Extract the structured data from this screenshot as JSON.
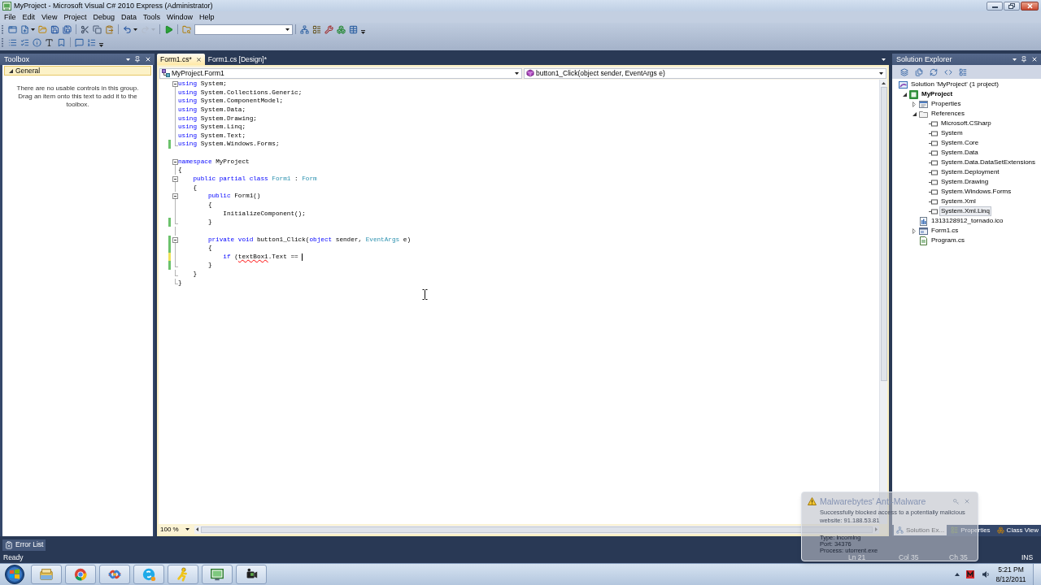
{
  "window": {
    "title": "MyProject - Microsoft Visual C# 2010 Express (Administrator)"
  },
  "menu": [
    "File",
    "Edit",
    "View",
    "Project",
    "Debug",
    "Data",
    "Tools",
    "Window",
    "Help"
  ],
  "toolbars": [
    [
      {
        "kind": "button",
        "disabled": false
      },
      {
        "kind": "split",
        "disabled": false
      },
      {
        "kind": "button",
        "disabled": false
      },
      {
        "kind": "button",
        "disabled": false
      },
      {
        "kind": "button",
        "disabled": false
      },
      {
        "kind": "separator"
      },
      {
        "kind": "button",
        "disabled": false
      },
      {
        "kind": "button",
        "disabled": false
      },
      {
        "kind": "button",
        "disabled": false
      },
      {
        "kind": "separator"
      },
      {
        "kind": "split",
        "disabled": false
      },
      {
        "kind": "split",
        "disabled": true
      },
      {
        "kind": "separator"
      },
      {
        "kind": "button",
        "disabled": false
      },
      {
        "kind": "separator"
      },
      {
        "kind": "button",
        "disabled": false
      },
      {
        "kind": "combo"
      },
      {
        "kind": "separator"
      },
      {
        "kind": "button",
        "disabled": false
      },
      {
        "kind": "button",
        "disabled": false
      },
      {
        "kind": "button",
        "disabled": false
      },
      {
        "kind": "button",
        "disabled": false
      },
      {
        "kind": "button",
        "disabled": false
      },
      {
        "kind": "overflow"
      }
    ],
    [
      {
        "kind": "button",
        "disabled": false
      },
      {
        "kind": "button",
        "disabled": false
      },
      {
        "kind": "button",
        "disabled": false
      },
      {
        "kind": "button",
        "disabled": false
      },
      {
        "kind": "button",
        "disabled": false
      },
      {
        "kind": "separator"
      },
      {
        "kind": "button",
        "disabled": false
      },
      {
        "kind": "button",
        "disabled": false
      },
      {
        "kind": "overflow"
      }
    ]
  ],
  "toolbox": {
    "title": "Toolbox",
    "groups": [
      {
        "label": "General",
        "expanded": true,
        "message": "There are no usable controls in this group. Drag an item onto this text to add it to the toolbox."
      }
    ]
  },
  "editor": {
    "tabs": [
      {
        "label": "Form1.cs*",
        "selected": true
      },
      {
        "label": "Form1.cs [Design]*",
        "selected": false
      }
    ],
    "type_dropdown": "MyProject.Form1",
    "member_dropdown": "button1_Click(object sender, EventArgs e)",
    "lines": [
      {
        "tokens": [
          {
            "text": "using",
            "kind": "keyword"
          },
          {
            "text": " System;",
            "kind": "plain"
          }
        ],
        "fold": {
          "kind": "start"
        },
        "caret": false
      },
      {
        "tokens": [
          {
            "text": "using",
            "kind": "keyword"
          },
          {
            "text": " System.Collections.Generic;",
            "kind": "plain"
          }
        ],
        "fold": {
          "kind": "inside"
        },
        "caret": false
      },
      {
        "tokens": [
          {
            "text": "using",
            "kind": "keyword"
          },
          {
            "text": " System.ComponentModel;",
            "kind": "plain"
          }
        ],
        "fold": {
          "kind": "inside"
        },
        "caret": false
      },
      {
        "tokens": [
          {
            "text": "using",
            "kind": "keyword"
          },
          {
            "text": " System.Data;",
            "kind": "plain"
          }
        ],
        "fold": {
          "kind": "inside"
        },
        "caret": false
      },
      {
        "tokens": [
          {
            "text": "using",
            "kind": "keyword"
          },
          {
            "text": " System.Drawing;",
            "kind": "plain"
          }
        ],
        "fold": {
          "kind": "inside"
        },
        "caret": false
      },
      {
        "tokens": [
          {
            "text": "using",
            "kind": "keyword"
          },
          {
            "text": " System.Linq;",
            "kind": "plain"
          }
        ],
        "fold": {
          "kind": "inside"
        },
        "caret": false
      },
      {
        "tokens": [
          {
            "text": "using",
            "kind": "keyword"
          },
          {
            "text": " System.Text;",
            "kind": "plain"
          }
        ],
        "fold": {
          "kind": "inside"
        },
        "caret": false
      },
      {
        "tokens": [
          {
            "text": "using",
            "kind": "keyword"
          },
          {
            "text": " System.Windows.Forms;",
            "kind": "plain"
          }
        ],
        "fold": {
          "kind": "end"
        },
        "color": "#6cc26c",
        "caret": false
      },
      {
        "caret": false
      },
      {
        "tokens": [
          {
            "text": "namespace",
            "kind": "keyword"
          },
          {
            "text": " MyProject",
            "kind": "plain"
          }
        ],
        "fold": {
          "kind": "start"
        },
        "caret": false
      },
      {
        "tokens": [
          {
            "text": "{",
            "kind": "plain"
          }
        ],
        "fold": {
          "kind": "inside"
        },
        "caret": false
      },
      {
        "tokens": [
          {
            "text": "    public partial class ",
            "kind": "keyword"
          },
          {
            "text": "Form1",
            "kind": "type"
          },
          {
            "text": " : ",
            "kind": "plain"
          },
          {
            "text": "Form",
            "kind": "type"
          }
        ],
        "fold": {
          "kind": "start"
        },
        "caret": false
      },
      {
        "tokens": [
          {
            "text": "    {",
            "kind": "plain"
          }
        ],
        "fold": {
          "kind": "inside"
        },
        "caret": false
      },
      {
        "tokens": [
          {
            "text": "        public ",
            "kind": "keyword"
          },
          {
            "text": "Form1()",
            "kind": "plain"
          }
        ],
        "fold": {
          "kind": "start"
        },
        "caret": false
      },
      {
        "tokens": [
          {
            "text": "        {",
            "kind": "plain"
          }
        ],
        "fold": {
          "kind": "inside"
        },
        "caret": false
      },
      {
        "tokens": [
          {
            "text": "            InitializeComponent();",
            "kind": "plain"
          }
        ],
        "fold": {
          "kind": "inside"
        },
        "caret": false
      },
      {
        "tokens": [
          {
            "text": "        }",
            "kind": "plain"
          }
        ],
        "fold": {
          "kind": "end"
        },
        "color": "#6cc26c",
        "caret": false
      },
      {
        "fold": {
          "kind": "inside"
        },
        "caret": false
      },
      {
        "tokens": [
          {
            "text": "        private void ",
            "kind": "keyword"
          },
          {
            "text": "button1_Click(",
            "kind": "plain"
          },
          {
            "text": "object ",
            "kind": "keyword"
          },
          {
            "text": "sender, ",
            "kind": "plain"
          },
          {
            "text": "EventArgs",
            "kind": "type"
          },
          {
            "text": " e)",
            "kind": "plain"
          }
        ],
        "fold": {
          "kind": "start"
        },
        "color": "#6cc26c",
        "caret": false
      },
      {
        "tokens": [
          {
            "text": "        {",
            "kind": "plain"
          }
        ],
        "fold": {
          "kind": "inside"
        },
        "color": "#6cc26c",
        "caret": false
      },
      {
        "tokens": [
          {
            "text": "            if ",
            "kind": "keyword"
          },
          {
            "text": "(",
            "kind": "plain"
          },
          {
            "text": "textBox1",
            "kind": "error"
          },
          {
            "text": ".Text == ",
            "kind": "plain"
          }
        ],
        "fold": {
          "kind": "inside"
        },
        "color": "#eee25a",
        "caret": true
      },
      {
        "tokens": [
          {
            "text": "        }",
            "kind": "plain"
          }
        ],
        "fold": {
          "kind": "end"
        },
        "color": "#6cc26c",
        "caret": false
      },
      {
        "tokens": [
          {
            "text": "    }",
            "kind": "plain"
          }
        ],
        "fold": {
          "kind": "end"
        },
        "caret": false
      },
      {
        "tokens": [
          {
            "text": "}",
            "kind": "plain"
          }
        ],
        "fold": {
          "kind": "end"
        },
        "caret": false
      }
    ],
    "zoom": "100 %"
  },
  "solution_explorer": {
    "title": "Solution Explorer",
    "tree": [
      {
        "label": "Solution 'MyProject' (1 project)",
        "kind": "solution",
        "selected": false,
        "children": [
          {
            "label": "MyProject",
            "kind": "project",
            "expanded": true,
            "selected": false,
            "children": [
              {
                "label": "Properties",
                "kind": "properties",
                "expanded": false,
                "selected": false
              },
              {
                "label": "References",
                "kind": "references",
                "expanded": true,
                "selected": false,
                "children": [
                  {
                    "label": "Microsoft.CSharp",
                    "kind": "reference",
                    "selected": false
                  },
                  {
                    "label": "System",
                    "kind": "reference",
                    "selected": false
                  },
                  {
                    "label": "System.Core",
                    "kind": "reference",
                    "selected": false
                  },
                  {
                    "label": "System.Data",
                    "kind": "reference",
                    "selected": false
                  },
                  {
                    "label": "System.Data.DataSetExtensions",
                    "kind": "reference",
                    "selected": false
                  },
                  {
                    "label": "System.Deployment",
                    "kind": "reference",
                    "selected": false
                  },
                  {
                    "label": "System.Drawing",
                    "kind": "reference",
                    "selected": false
                  },
                  {
                    "label": "System.Windows.Forms",
                    "kind": "reference",
                    "selected": false
                  },
                  {
                    "label": "System.Xml",
                    "kind": "reference",
                    "selected": false
                  },
                  {
                    "label": "System.Xml.Linq",
                    "kind": "reference",
                    "selected": true
                  }
                ]
              },
              {
                "label": "1313128912_tornado.ico",
                "kind": "icon-file",
                "selected": false
              },
              {
                "label": "Form1.cs",
                "kind": "form",
                "expanded": false,
                "selected": false
              },
              {
                "label": "Program.cs",
                "kind": "code-file",
                "selected": false
              }
            ]
          }
        ]
      }
    ],
    "tabs": [
      {
        "label": "Solution Ex...",
        "selected": true
      },
      {
        "label": "Properties",
        "selected": false
      },
      {
        "label": "Class View",
        "selected": false
      }
    ]
  },
  "error_list_tab": "Error List",
  "status_bar": {
    "message": "Ready",
    "line": "Ln 21",
    "column": "Col 35",
    "char": "Ch 35",
    "mode": "INS"
  },
  "notification": {
    "title": "Malwarebytes' Anti-Malware",
    "message": "Successfully blocked access to a potentially malicious website: 91.188.53.81",
    "details": [
      "Type: incoming",
      "Port: 34376",
      "Process: utorrent.exe"
    ]
  },
  "taskbar": {
    "clock": {
      "time": "5:21 PM",
      "date": "8/12/2011"
    }
  }
}
